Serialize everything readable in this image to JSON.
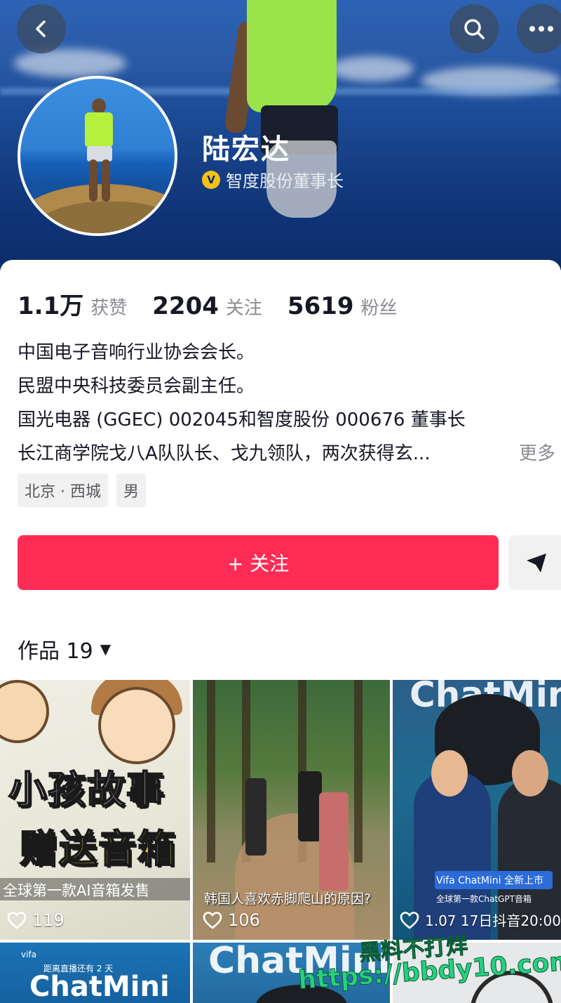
{
  "profile": {
    "name": "陆宏达",
    "verified_title": "智度股份董事长",
    "verified_badge": "V"
  },
  "header_actions": {
    "back_icon": "chevron-left-icon",
    "search_icon": "search-icon",
    "more_icon": "more-dots-icon"
  },
  "stats": [
    {
      "value": "1.1万",
      "label": "获赞"
    },
    {
      "value": "2204",
      "label": "关注"
    },
    {
      "value": "5619",
      "label": "粉丝"
    }
  ],
  "bio": {
    "lines": [
      "中国电子音响行业协会会长。",
      "民盟中央科技委员会副主任。",
      "国光电器 (GGEC) 002045和智度股份 000676 董事长",
      "长江商学院戈八A队队长、戈九领队，两次获得玄..."
    ],
    "more": "更多"
  },
  "tags": [
    "北京 · 西城",
    "男"
  ],
  "follow_button": {
    "label": "+ 关注"
  },
  "works": {
    "label": "作品 19",
    "caret": "▼"
  },
  "posts": [
    {
      "title_line1": "小孩故事",
      "title_line2": "赠送音箱",
      "caption": "全球第一款AI音箱发售",
      "likes": "119"
    },
    {
      "caption": "韩国人喜欢赤脚爬山的原因?",
      "likes": "106"
    },
    {
      "logo": "ChatMini",
      "caption": "Vifa ChatMini 全新上市",
      "caption2": "全球第一款ChatGPT音箱",
      "likes": "1.07 17日抖音20:00"
    },
    {
      "brand": "vifa",
      "sub": "距离直播还有 2 天",
      "logo": "ChatMini"
    },
    {
      "logo": "ChatMini"
    },
    {}
  ],
  "watermark": {
    "line1": "黑料不打烊",
    "line2": "https://bbdy10.com"
  },
  "colors": {
    "follow": "#fe2c55",
    "verify_badge": "#f2c21a",
    "watermark": "#27d07f"
  }
}
